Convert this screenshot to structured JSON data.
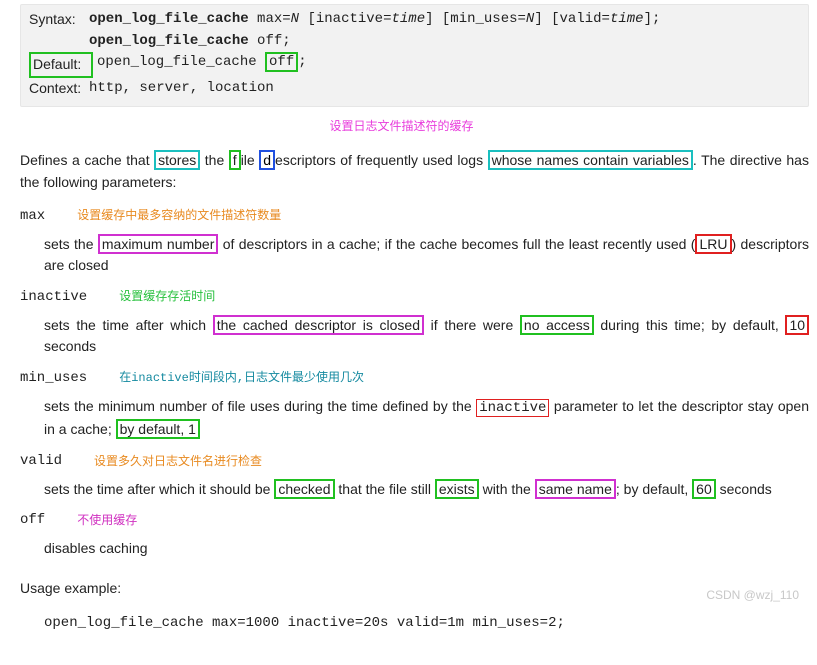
{
  "syntax": {
    "label": "Syntax:",
    "line1_dir": "open_log_file_cache",
    "line1_rest": " max=",
    "line1_N1": "N",
    "line1_mid1": " [inactive=",
    "line1_time1": "time",
    "line1_mid2": "] [min_uses=",
    "line1_N2": "N",
    "line1_mid3": "] [valid=",
    "line1_time2": "time",
    "line1_end": "];",
    "line2_dir": "open_log_file_cache",
    "line2_rest": " off;"
  },
  "default": {
    "label": "Default:",
    "dir": "open_log_file_cache ",
    "off": "off",
    "semi": ";"
  },
  "context": {
    "label": "Context:",
    "value": "http, server, location"
  },
  "anno": {
    "title": "设置日志文件描述符的缓存",
    "max": "设置缓存中最多容纳的文件描述符数量",
    "inactive": "设置缓存存活时间",
    "minuses": "在inactive时间段内,日志文件最少使用几次",
    "valid": "设置多久对日志文件名进行检查",
    "off": "不使用缓存"
  },
  "intro": {
    "pre": "Defines a cache that ",
    "stores": "stores",
    "mid1": " the ",
    "f": "f",
    "ile": "ile ",
    "d": "d",
    "mid2": "escriptors of frequently used logs ",
    "whose": "whose names contain variables",
    "after": ". The directive has the following parameters:"
  },
  "params": {
    "max": {
      "name": "max",
      "pre": "sets the ",
      "maxnum": "maximum number",
      "mid": " of descriptors in a cache; if the cache becomes full the least recently used (",
      "lru": "LRU",
      "post": ") descriptors are closed"
    },
    "inactive": {
      "name": "inactive",
      "pre": "sets the time after which ",
      "cached": "the cached descriptor is closed",
      "mid": " if there were ",
      "noaccess": "no access",
      "mid2": " during this time; by default, ",
      "ten": "10",
      "post": " seconds"
    },
    "minuses": {
      "name": "min_uses",
      "pre": "sets the minimum number of file uses during the time defined by the ",
      "inactive": "inactive",
      "mid": " parameter to let the descriptor stay open in a cache; ",
      "bydef": "by default, 1"
    },
    "valid": {
      "name": "valid",
      "pre": "sets the time after which it should be ",
      "checked": "checked",
      "mid": " that the file still ",
      "exists": "exists",
      "mid2": " with the ",
      "samename": "same name",
      "mid3": "; by default, ",
      "sixty": "60",
      "post": " seconds"
    },
    "off": {
      "name": "off",
      "desc": "disables caching"
    }
  },
  "usage": {
    "title": "Usage example:",
    "code": "open_log_file_cache max=1000 inactive=20s valid=1m min_uses=2;"
  },
  "watermark": "CSDN @wzj_110"
}
